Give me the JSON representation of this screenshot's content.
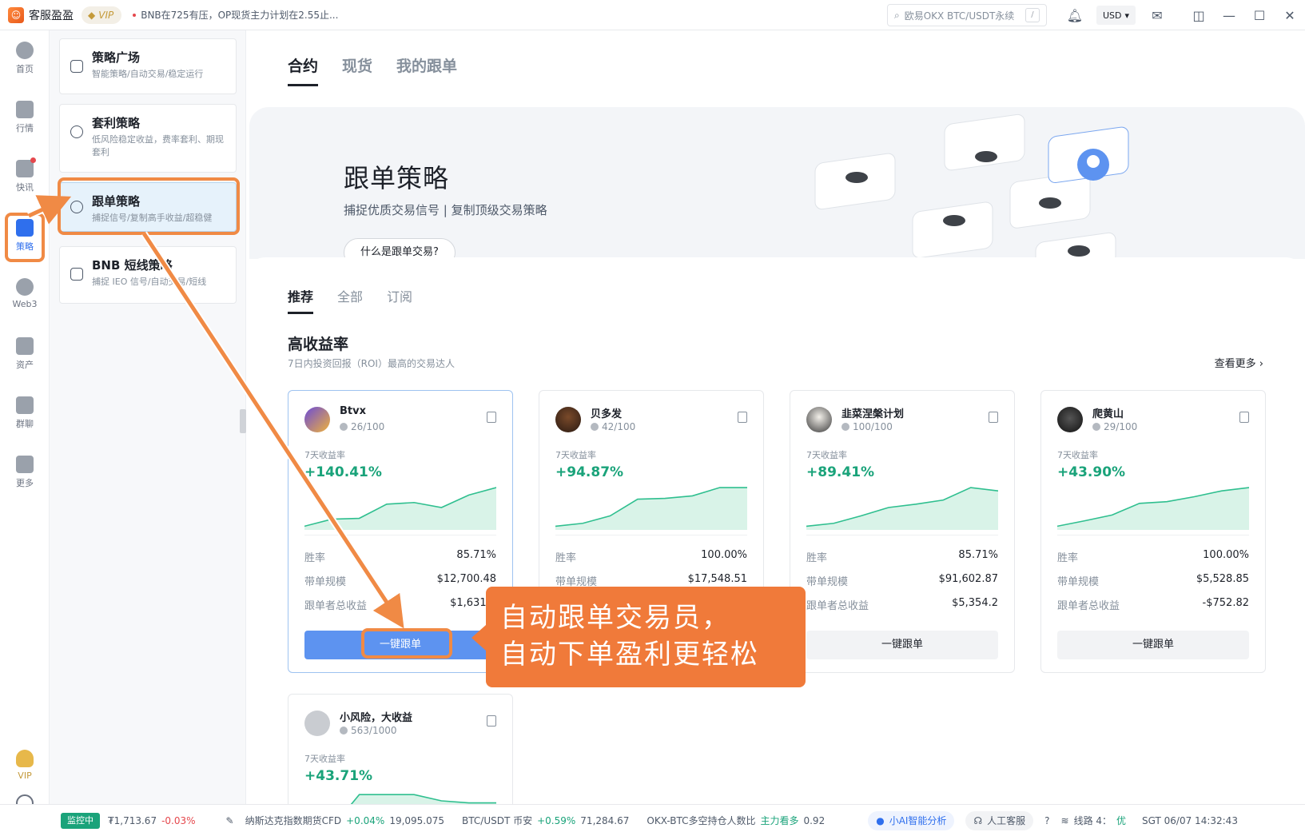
{
  "app": {
    "logo_text": "客服盈盈",
    "vip_label": "VIP",
    "news": "BNB在725有压，OP现货主力计划在2.55止..."
  },
  "topbar": {
    "search_placeholder": "欧易OKX BTC/USDT永续",
    "search_shortcut": "/",
    "currency": "USD"
  },
  "rail": {
    "items": [
      {
        "label": "首页",
        "icon": "home-icon"
      },
      {
        "label": "行情",
        "icon": "chart-bar-icon"
      },
      {
        "label": "快讯",
        "icon": "news-icon"
      },
      {
        "label": "策略",
        "icon": "robot-icon"
      },
      {
        "label": "Web3",
        "icon": "web3-icon"
      },
      {
        "label": "资产",
        "icon": "wallet-icon"
      },
      {
        "label": "群聊",
        "icon": "chat-icon"
      },
      {
        "label": "更多",
        "icon": "grid-icon"
      }
    ],
    "vip_label": "VIP"
  },
  "subnav": [
    {
      "title": "策略广场",
      "desc": "智能策略/自动交易/稳定运行"
    },
    {
      "title": "套利策略",
      "desc": "低风险稳定收益，费率套利、期现套利"
    },
    {
      "title": "跟单策略",
      "desc": "捕捉信号/复制高手收益/超稳健"
    },
    {
      "title": "BNB 短线策略",
      "desc": "捕捉 IEO 信号/自动交易/短线"
    }
  ],
  "main_tabs": [
    "合约",
    "现货",
    "我的跟单"
  ],
  "hero": {
    "title": "跟单策略",
    "subtitle": "捕捉优质交易信号 | 复制顶级交易策略",
    "button": "什么是跟单交易?"
  },
  "sub_tabs": [
    "推荐",
    "全部",
    "订阅"
  ],
  "section": {
    "title": "高收益率",
    "desc": "7日内投资回报（ROI）最高的交易达人",
    "more": "查看更多"
  },
  "card_labels": {
    "roi": "7天收益率",
    "win_rate": "胜率",
    "scale": "带单规模",
    "follower_profit": "跟单者总收益",
    "follow_button": "一键跟单"
  },
  "traders": [
    {
      "name": "Btvx",
      "count": "26/100",
      "roi": "+140.41%",
      "win_rate": "85.71%",
      "scale": "$12,700.48",
      "follower_profit": "$1,631.4",
      "curve": [
        0.05,
        0.22,
        0.24,
        0.58,
        0.62,
        0.5,
        0.8,
        0.98
      ]
    },
    {
      "name": "贝多发",
      "count": "42/100",
      "roi": "+94.87%",
      "win_rate": "100.00%",
      "scale": "$17,548.51",
      "follower_profit": "",
      "curve": [
        0.05,
        0.12,
        0.3,
        0.7,
        0.72,
        0.78,
        0.98,
        0.98
      ]
    },
    {
      "name": "韭菜涅槃计划",
      "count": "100/100",
      "roi": "+89.41%",
      "win_rate": "85.71%",
      "scale": "$91,602.87",
      "follower_profit": "$5,354.2",
      "curve": [
        0.05,
        0.12,
        0.3,
        0.5,
        0.58,
        0.68,
        0.98,
        0.9
      ]
    },
    {
      "name": "爬黄山",
      "count": "29/100",
      "roi": "+43.90%",
      "win_rate": "100.00%",
      "scale": "$5,528.85",
      "follower_profit": "-$752.82",
      "curve": [
        0.05,
        0.18,
        0.32,
        0.6,
        0.64,
        0.76,
        0.9,
        0.98
      ]
    },
    {
      "name": "小风险，大收益",
      "count": "563/1000",
      "roi": "+43.71%",
      "curve": [
        0.0,
        0.1,
        0.9,
        0.9,
        0.9,
        0.75,
        0.7,
        0.7
      ]
    }
  ],
  "callout": {
    "line1": "自动跟单交易员，",
    "line2": "自动下单盈利更轻松"
  },
  "statusbar": {
    "live": "监控中",
    "price": "₮1,713.67",
    "price_change": "-0.03%",
    "m1_name": "纳斯达克指数期货CFD",
    "m1_change": "+0.04%",
    "m1_value": "19,095.075",
    "m2_name": "BTC/USDT 币安",
    "m2_change": "+0.59%",
    "m2_value": "71,284.67",
    "m3_name": "OKX-BTC多空持仓人数比",
    "m3_tag": "主力看多",
    "m3_value": "0.92",
    "ai": "小AI智能分析",
    "cs": "人工客服",
    "line": "线路 4：",
    "line_quality": "优",
    "time": "SGT 06/07 14:32:43"
  }
}
